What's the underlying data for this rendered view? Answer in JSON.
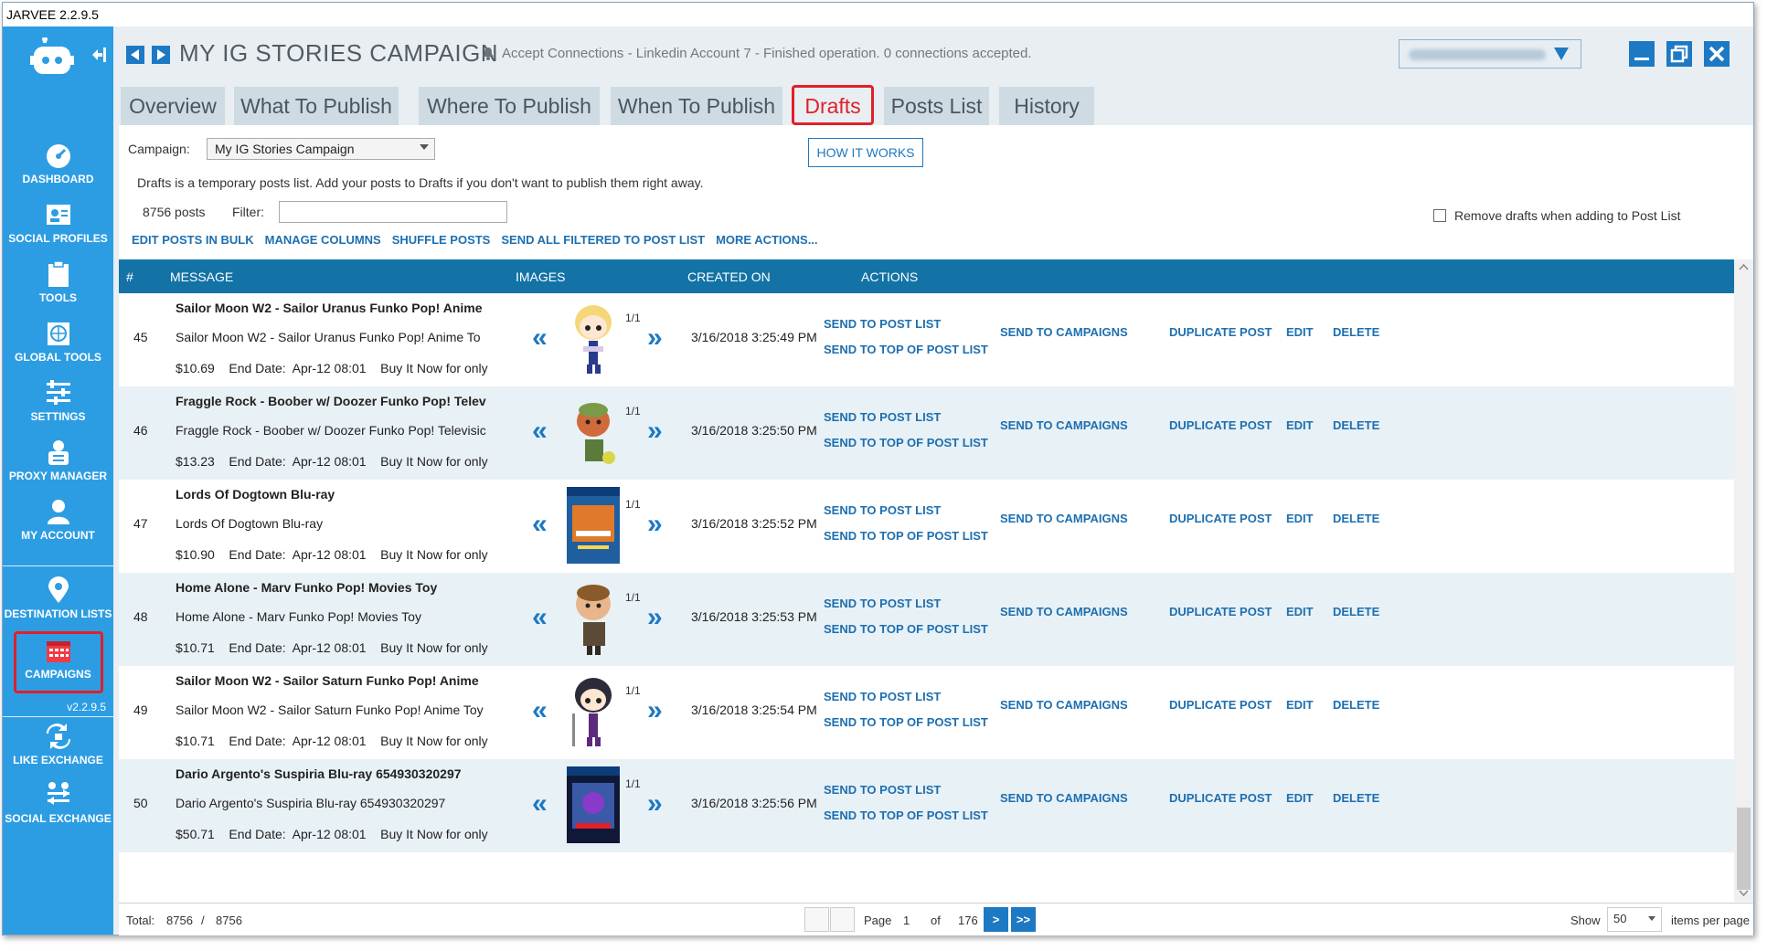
{
  "app": {
    "title": "JARVEE 2.2.9.5",
    "version": "v2.2.9.5"
  },
  "sidebar": {
    "items": [
      {
        "label": "DASHBOARD",
        "icon": "dashboard-icon"
      },
      {
        "label": "SOCIAL PROFILES",
        "icon": "profile-card-icon"
      },
      {
        "label": "TOOLS",
        "icon": "clipboard-icon"
      },
      {
        "label": "GLOBAL TOOLS",
        "icon": "globe-icon"
      },
      {
        "label": "SETTINGS",
        "icon": "sliders-icon"
      },
      {
        "label": "PROXY MANAGER",
        "icon": "proxy-icon"
      },
      {
        "label": "MY ACCOUNT",
        "icon": "user-icon"
      },
      {
        "label": "DESTINATION LISTS",
        "icon": "map-pin-icon"
      },
      {
        "label": "CAMPAIGNS",
        "icon": "calendar-icon"
      },
      {
        "label": "LIKE EXCHANGE",
        "icon": "like-exchange-icon"
      },
      {
        "label": "SOCIAL EXCHANGE",
        "icon": "social-exchange-icon"
      }
    ],
    "active": "CAMPAIGNS"
  },
  "header": {
    "title": "MY IG STORIES CAMPAIGN",
    "notification": "Accept Connections - Linkedin Account 7 - Finished operation. 0 connections accepted."
  },
  "tabs": [
    {
      "label": "Overview"
    },
    {
      "label": "What To Publish"
    },
    {
      "label": "Where To Publish"
    },
    {
      "label": "When To Publish"
    },
    {
      "label": "Drafts"
    },
    {
      "label": "Posts List"
    },
    {
      "label": "History"
    }
  ],
  "active_tab": "Drafts",
  "drafts": {
    "campaign_label": "Campaign:",
    "campaign_value": "My IG Stories Campaign",
    "how_it_works": "HOW IT WORKS",
    "description": "Drafts is a temporary posts list. Add your posts to Drafts if you don't want to publish them right away.",
    "post_count": "8756 posts",
    "filter_label": "Filter:",
    "filter_value": "",
    "remove_drafts_label": "Remove drafts when adding to Post List",
    "remove_drafts_checked": false,
    "bulk_actions": [
      "EDIT POSTS IN BULK",
      "MANAGE COLUMNS",
      "SHUFFLE POSTS",
      "SEND ALL FILTERED TO POST LIST",
      "MORE ACTIONS..."
    ]
  },
  "table": {
    "columns": [
      "#",
      "MESSAGE",
      "IMAGES",
      "CREATED ON",
      "ACTIONS"
    ],
    "action_labels": {
      "send": "SEND TO POST LIST",
      "send_top": "SEND TO TOP OF POST LIST",
      "campaigns": "SEND TO CAMPAIGNS",
      "duplicate": "DUPLICATE POST",
      "edit": "EDIT",
      "delete": "DELETE"
    },
    "rows": [
      {
        "num": "45",
        "title": "Sailor Moon W2 - Sailor Uranus Funko Pop! Anime",
        "line": "Sailor Moon W2 - Sailor Uranus Funko Pop! Anime To",
        "price": "$10.69    End Date:  Apr-12 08:01    Buy It Now for only",
        "image_count": "1/1",
        "created": "3/16/2018 3:25:49 PM",
        "thumb": "funko-uranus"
      },
      {
        "num": "46",
        "title": "Fraggle Rock - Boober w/ Doozer Funko Pop! Telev",
        "line": "Fraggle Rock - Boober w/ Doozer Funko Pop! Televisic",
        "price": "$13.23    End Date:  Apr-12 08:01    Buy It Now for only",
        "image_count": "1/1",
        "created": "3/16/2018 3:25:50 PM",
        "thumb": "funko-boober"
      },
      {
        "num": "47",
        "title": "Lords Of Dogtown Blu-ray",
        "line": "Lords Of Dogtown Blu-ray",
        "price": "$10.90    End Date:  Apr-12 08:01    Buy It Now for only",
        "image_count": "1/1",
        "created": "3/16/2018 3:25:52 PM",
        "thumb": "bluray-dogtown"
      },
      {
        "num": "48",
        "title": "Home Alone - Marv Funko Pop! Movies Toy",
        "line": "Home Alone - Marv Funko Pop! Movies Toy",
        "price": "$10.71    End Date:  Apr-12 08:01    Buy It Now for only",
        "image_count": "1/1",
        "created": "3/16/2018 3:25:53 PM",
        "thumb": "funko-marv"
      },
      {
        "num": "49",
        "title": "Sailor Moon W2 - Sailor Saturn Funko Pop! Anime",
        "line": "Sailor Moon W2 - Sailor Saturn Funko Pop! Anime Toy",
        "price": "$10.71    End Date:  Apr-12 08:01    Buy It Now for only",
        "image_count": "1/1",
        "created": "3/16/2018 3:25:54 PM",
        "thumb": "funko-saturn"
      },
      {
        "num": "50",
        "title": "Dario Argento's Suspiria Blu-ray 654930320297",
        "line": "Dario Argento's Suspiria Blu-ray 654930320297",
        "price": "$50.71    End Date:  Apr-12 08:01    Buy It Now for only",
        "image_count": "1/1",
        "created": "3/16/2018 3:25:56 PM",
        "thumb": "bluray-suspiria"
      }
    ]
  },
  "footer": {
    "total_label": "Total:",
    "total_a": "8756",
    "slash": "/",
    "total_b": "8756",
    "page_label": "Page",
    "page_num": "1",
    "of_label": "of",
    "page_total": "176",
    "next": ">",
    "last": ">>",
    "show_label": "Show",
    "per_page": "50",
    "items_per_page": "items per page"
  },
  "colors": {
    "sidebar": "#2d9de3",
    "accent": "#1d79c4",
    "table_header": "#1373a6",
    "highlight": "#e0202a"
  }
}
